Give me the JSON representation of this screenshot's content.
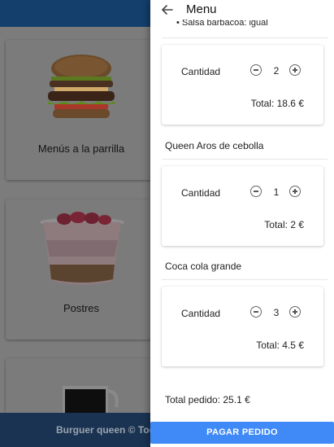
{
  "background": {
    "categories": [
      {
        "label": "Menús a la parrilla"
      },
      {
        "label": "Postres"
      },
      {
        "label": ""
      }
    ],
    "footer_text": "Burguer queen © Tod"
  },
  "drawer": {
    "title": "Menu",
    "back_icon": "arrow-left-icon",
    "cut_text": "Salsa barbacoa: igual",
    "items": [
      {
        "name": "",
        "quantity_label": "Cantidad",
        "quantity": "2",
        "total": "Total: 18.6 €"
      },
      {
        "name": "Queen Aros de cebolla",
        "quantity_label": "Cantidad",
        "quantity": "1",
        "total": "Total: 2 €"
      },
      {
        "name": "Coca cola grande",
        "quantity_label": "Cantidad",
        "quantity": "3",
        "total": "Total: 4.5 €"
      }
    ],
    "order_total": "Total pedido: 25.1 €",
    "pay_button": "PAGAR PEDIDO"
  },
  "colors": {
    "header": "#143e6b",
    "footer": "#1a3352",
    "pay_button": "#3f8af7",
    "overlay": "#7c7c7c"
  }
}
